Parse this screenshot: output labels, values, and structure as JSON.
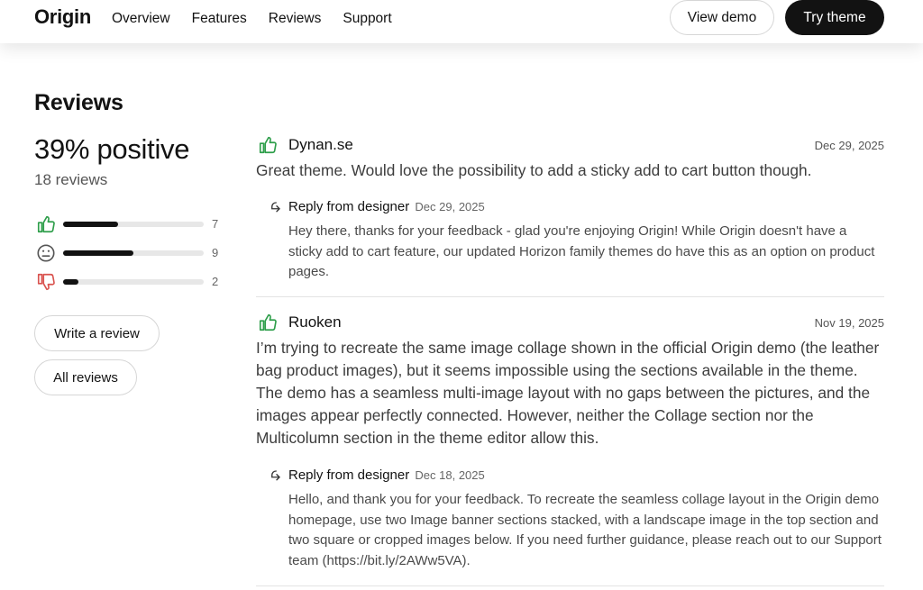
{
  "header": {
    "brand": "Origin",
    "nav": [
      "Overview",
      "Features",
      "Reviews",
      "Support"
    ],
    "view_demo": "View demo",
    "try_theme": "Try theme"
  },
  "reviews_section": {
    "title": "Reviews",
    "percent_positive": "39% positive",
    "review_count": "18 reviews",
    "breakdown": [
      {
        "type": "positive",
        "icon": "thumbs-up-icon",
        "count": "7",
        "fraction": 0.39,
        "color": "#2e9e4a"
      },
      {
        "type": "neutral",
        "icon": "neutral-face-icon",
        "count": "9",
        "fraction": 0.5,
        "color": "#555555"
      },
      {
        "type": "negative",
        "icon": "thumbs-down-icon",
        "count": "2",
        "fraction": 0.11,
        "color": "#d9534f"
      }
    ],
    "write_review": "Write a review",
    "all_reviews": "All reviews"
  },
  "reviews": [
    {
      "author": "Dynan.se",
      "date": "Dec 29, 2025",
      "sentiment_icon": "thumbs-up-icon",
      "body": "Great theme. Would love the possibility to add a sticky add to cart button though.",
      "reply": {
        "label": "Reply from designer",
        "date": "Dec 29, 2025",
        "body": "Hey there, thanks for your feedback - glad you're enjoying Origin! While Origin doesn't have a sticky add to cart feature, our updated Horizon family themes do have this as an option on product pages."
      }
    },
    {
      "author": "Ruoken",
      "date": "Nov 19, 2025",
      "sentiment_icon": "thumbs-up-icon",
      "body": "I’m trying to recreate the same image collage shown in the official Origin demo (the leather bag product images), but it seems impossible using the sections available in the theme. The demo has a seamless multi-image layout with no gaps between the pictures, and the images appear perfectly connected. However, neither the Collage section nor the Multicolumn section in the theme editor allow this.",
      "reply": {
        "label": "Reply from designer",
        "date": "Dec 18, 2025",
        "body": "Hello, and thank you for your feedback. To recreate the seamless collage layout in the Origin demo homepage, use two Image banner sections stacked, with a landscape image in the top section and two square or cropped images below. If you need further guidance, please reach out to our Support team (https://bit.ly/2AWw5VA)."
      }
    }
  ]
}
